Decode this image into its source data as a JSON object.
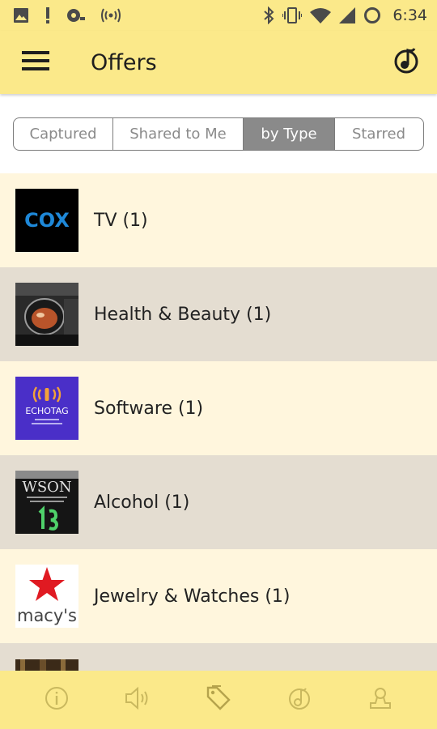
{
  "status_bar": {
    "time": "6:34",
    "icons": [
      "image-notification-icon",
      "alert-notification-icon",
      "voicemail-icon",
      "broadcast-icon",
      "bluetooth-icon",
      "vibrate-icon",
      "wifi-icon",
      "cell-signal-icon",
      "sync-circle-icon"
    ]
  },
  "app_bar": {
    "title": "Offers",
    "menu_icon": "hamburger-menu-icon",
    "action_icon": "music-note-icon"
  },
  "tabs": [
    {
      "label": "Captured",
      "active": false
    },
    {
      "label": "Shared to Me",
      "active": false
    },
    {
      "label": "by Type",
      "active": true
    },
    {
      "label": "Starred",
      "active": false
    }
  ],
  "categories": [
    {
      "label": "TV (1)",
      "thumb_text": "COX"
    },
    {
      "label": "Health & Beauty (1)",
      "thumb_text": ""
    },
    {
      "label": "Software (1)",
      "thumb_text": "ECHOTAG"
    },
    {
      "label": "Alcohol (1)",
      "thumb_text": "WSON"
    },
    {
      "label": "Jewelry & Watches (1)",
      "thumb_text": "macy's"
    }
  ],
  "bottom_nav": [
    {
      "icon": "info-icon"
    },
    {
      "icon": "speaker-icon"
    },
    {
      "icon": "tags-icon",
      "active": true
    },
    {
      "icon": "music-disc-icon"
    },
    {
      "icon": "user-icon"
    }
  ],
  "colors": {
    "primary": "#fbe98a",
    "row_light": "#fff6dd",
    "row_dark": "#e4ddd1",
    "tab_active": "#8a8a8a"
  }
}
